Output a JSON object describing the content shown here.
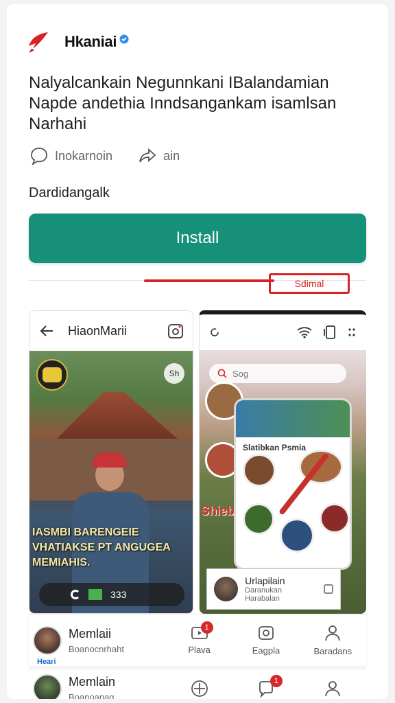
{
  "app": {
    "name": "Hkaniai",
    "verified": true,
    "brand_color": "#d82222"
  },
  "headline": "Nalyalcankain Negunnkani IBalandamian Napde andethia Inndsangankam isamlsan Narhahi",
  "actions": {
    "comment_label": "Inokarnoin",
    "share_label": "ain"
  },
  "subtitle": "Dardidangalk",
  "install": {
    "label": "Install",
    "color": "#17907a"
  },
  "highlight": {
    "badge_label": "Sdimal"
  },
  "screenshot_left": {
    "title": "HiaonMarii",
    "share_text": "Sh",
    "caption": "IASMBI BARENGEIE VHATIAKSE PT ANGUGEA MEMIAHIS.",
    "pill_count": "333"
  },
  "screenshot_right": {
    "search_placeholder": "Sog",
    "card_title": "Slatibkan Psmia",
    "overlay_label": "Shiebnis",
    "note_title": "Urlapilain",
    "note_subtitle": "Daranukan Harabalan"
  },
  "bottom_nav": {
    "profile_name": "Memlaii",
    "profile_sub": "Boanocnrhaht",
    "profile_tag": "Heari",
    "items": [
      {
        "label": "Plava",
        "icon": "video-icon",
        "badge": "1"
      },
      {
        "label": "Eagplа",
        "icon": "camera-icon"
      },
      {
        "label": "Baradans",
        "icon": "person-icon"
      }
    ]
  },
  "bottom_nav2": {
    "profile_name": "Memlain",
    "profile_sub": "Boanoanag",
    "bubble_badge": "1"
  }
}
